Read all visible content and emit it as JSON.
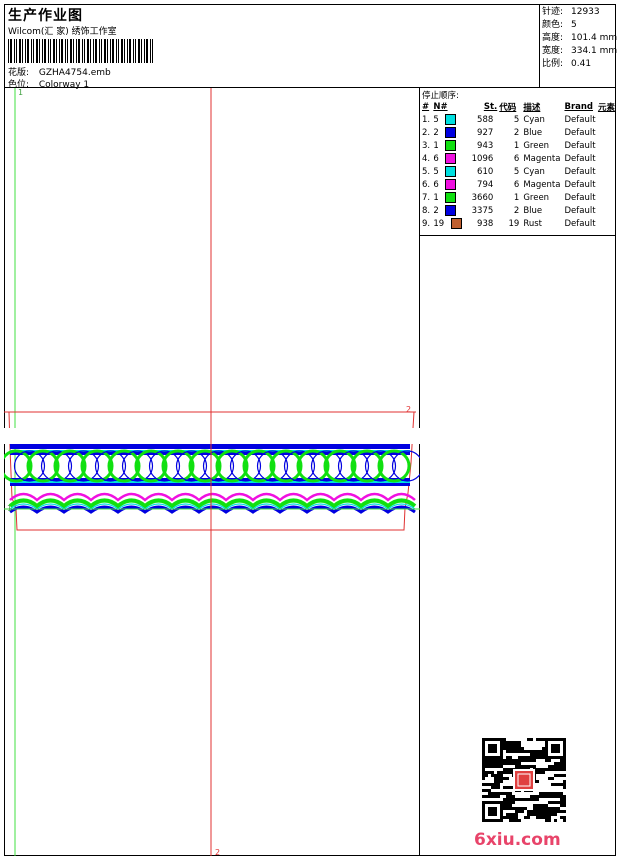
{
  "header": {
    "title": "生产作业图",
    "subtitle": "Wilcom(汇 家) 绣饰工作室",
    "design_label": "花版:",
    "design_value": "GZHA4754.emb",
    "colorway_label": "色位:",
    "colorway_value": "Colorway 1"
  },
  "stats": [
    {
      "label": "针迹:",
      "value": "12933"
    },
    {
      "label": "颜色:",
      "value": "5"
    },
    {
      "label": "高度:",
      "value": "101.4 mm"
    },
    {
      "label": "宽度:",
      "value": "334.1 mm"
    },
    {
      "label": "比例:",
      "value": "0.41"
    }
  ],
  "markers": {
    "top_left": "1",
    "left_mid": "1",
    "right_top": "2",
    "bottom": "2"
  },
  "stop_sequence": {
    "title": "停止顺序:",
    "columns": [
      "#",
      "N#",
      "St.",
      "代码",
      "描述",
      "Brand",
      "元素"
    ],
    "rows": [
      {
        "idx": "1.",
        "n": "5",
        "color": "#00e0e0",
        "st": "588",
        "code": "5",
        "desc": "Cyan",
        "brand": "Default"
      },
      {
        "idx": "2.",
        "n": "2",
        "color": "#0000e0",
        "st": "927",
        "code": "2",
        "desc": "Blue",
        "brand": "Default"
      },
      {
        "idx": "3.",
        "n": "1",
        "color": "#10e010",
        "st": "943",
        "code": "1",
        "desc": "Green",
        "brand": "Default"
      },
      {
        "idx": "4.",
        "n": "6",
        "color": "#f010e0",
        "st": "1096",
        "code": "6",
        "desc": "Magenta",
        "brand": "Default"
      },
      {
        "idx": "5.",
        "n": "5",
        "color": "#00e0e0",
        "st": "610",
        "code": "5",
        "desc": "Cyan",
        "brand": "Default"
      },
      {
        "idx": "6.",
        "n": "6",
        "color": "#f010e0",
        "st": "794",
        "code": "6",
        "desc": "Magenta",
        "brand": "Default"
      },
      {
        "idx": "7.",
        "n": "1",
        "color": "#10e010",
        "st": "3660",
        "code": "1",
        "desc": "Green",
        "brand": "Default"
      },
      {
        "idx": "8.",
        "n": "2",
        "color": "#0000e0",
        "st": "3375",
        "code": "2",
        "desc": "Blue",
        "brand": "Default"
      },
      {
        "idx": "9.",
        "n": "19",
        "color": "#c06030",
        "st": "938",
        "code": "19",
        "desc": "Rust",
        "brand": "Default"
      }
    ]
  },
  "design_colors": {
    "blue": "#0000e0",
    "green": "#10e010",
    "magenta": "#f010e0",
    "cyan": "#00e0e0",
    "guide_green": "#40e040",
    "guide_red": "#e03030"
  },
  "watermark": "6xiu.com"
}
